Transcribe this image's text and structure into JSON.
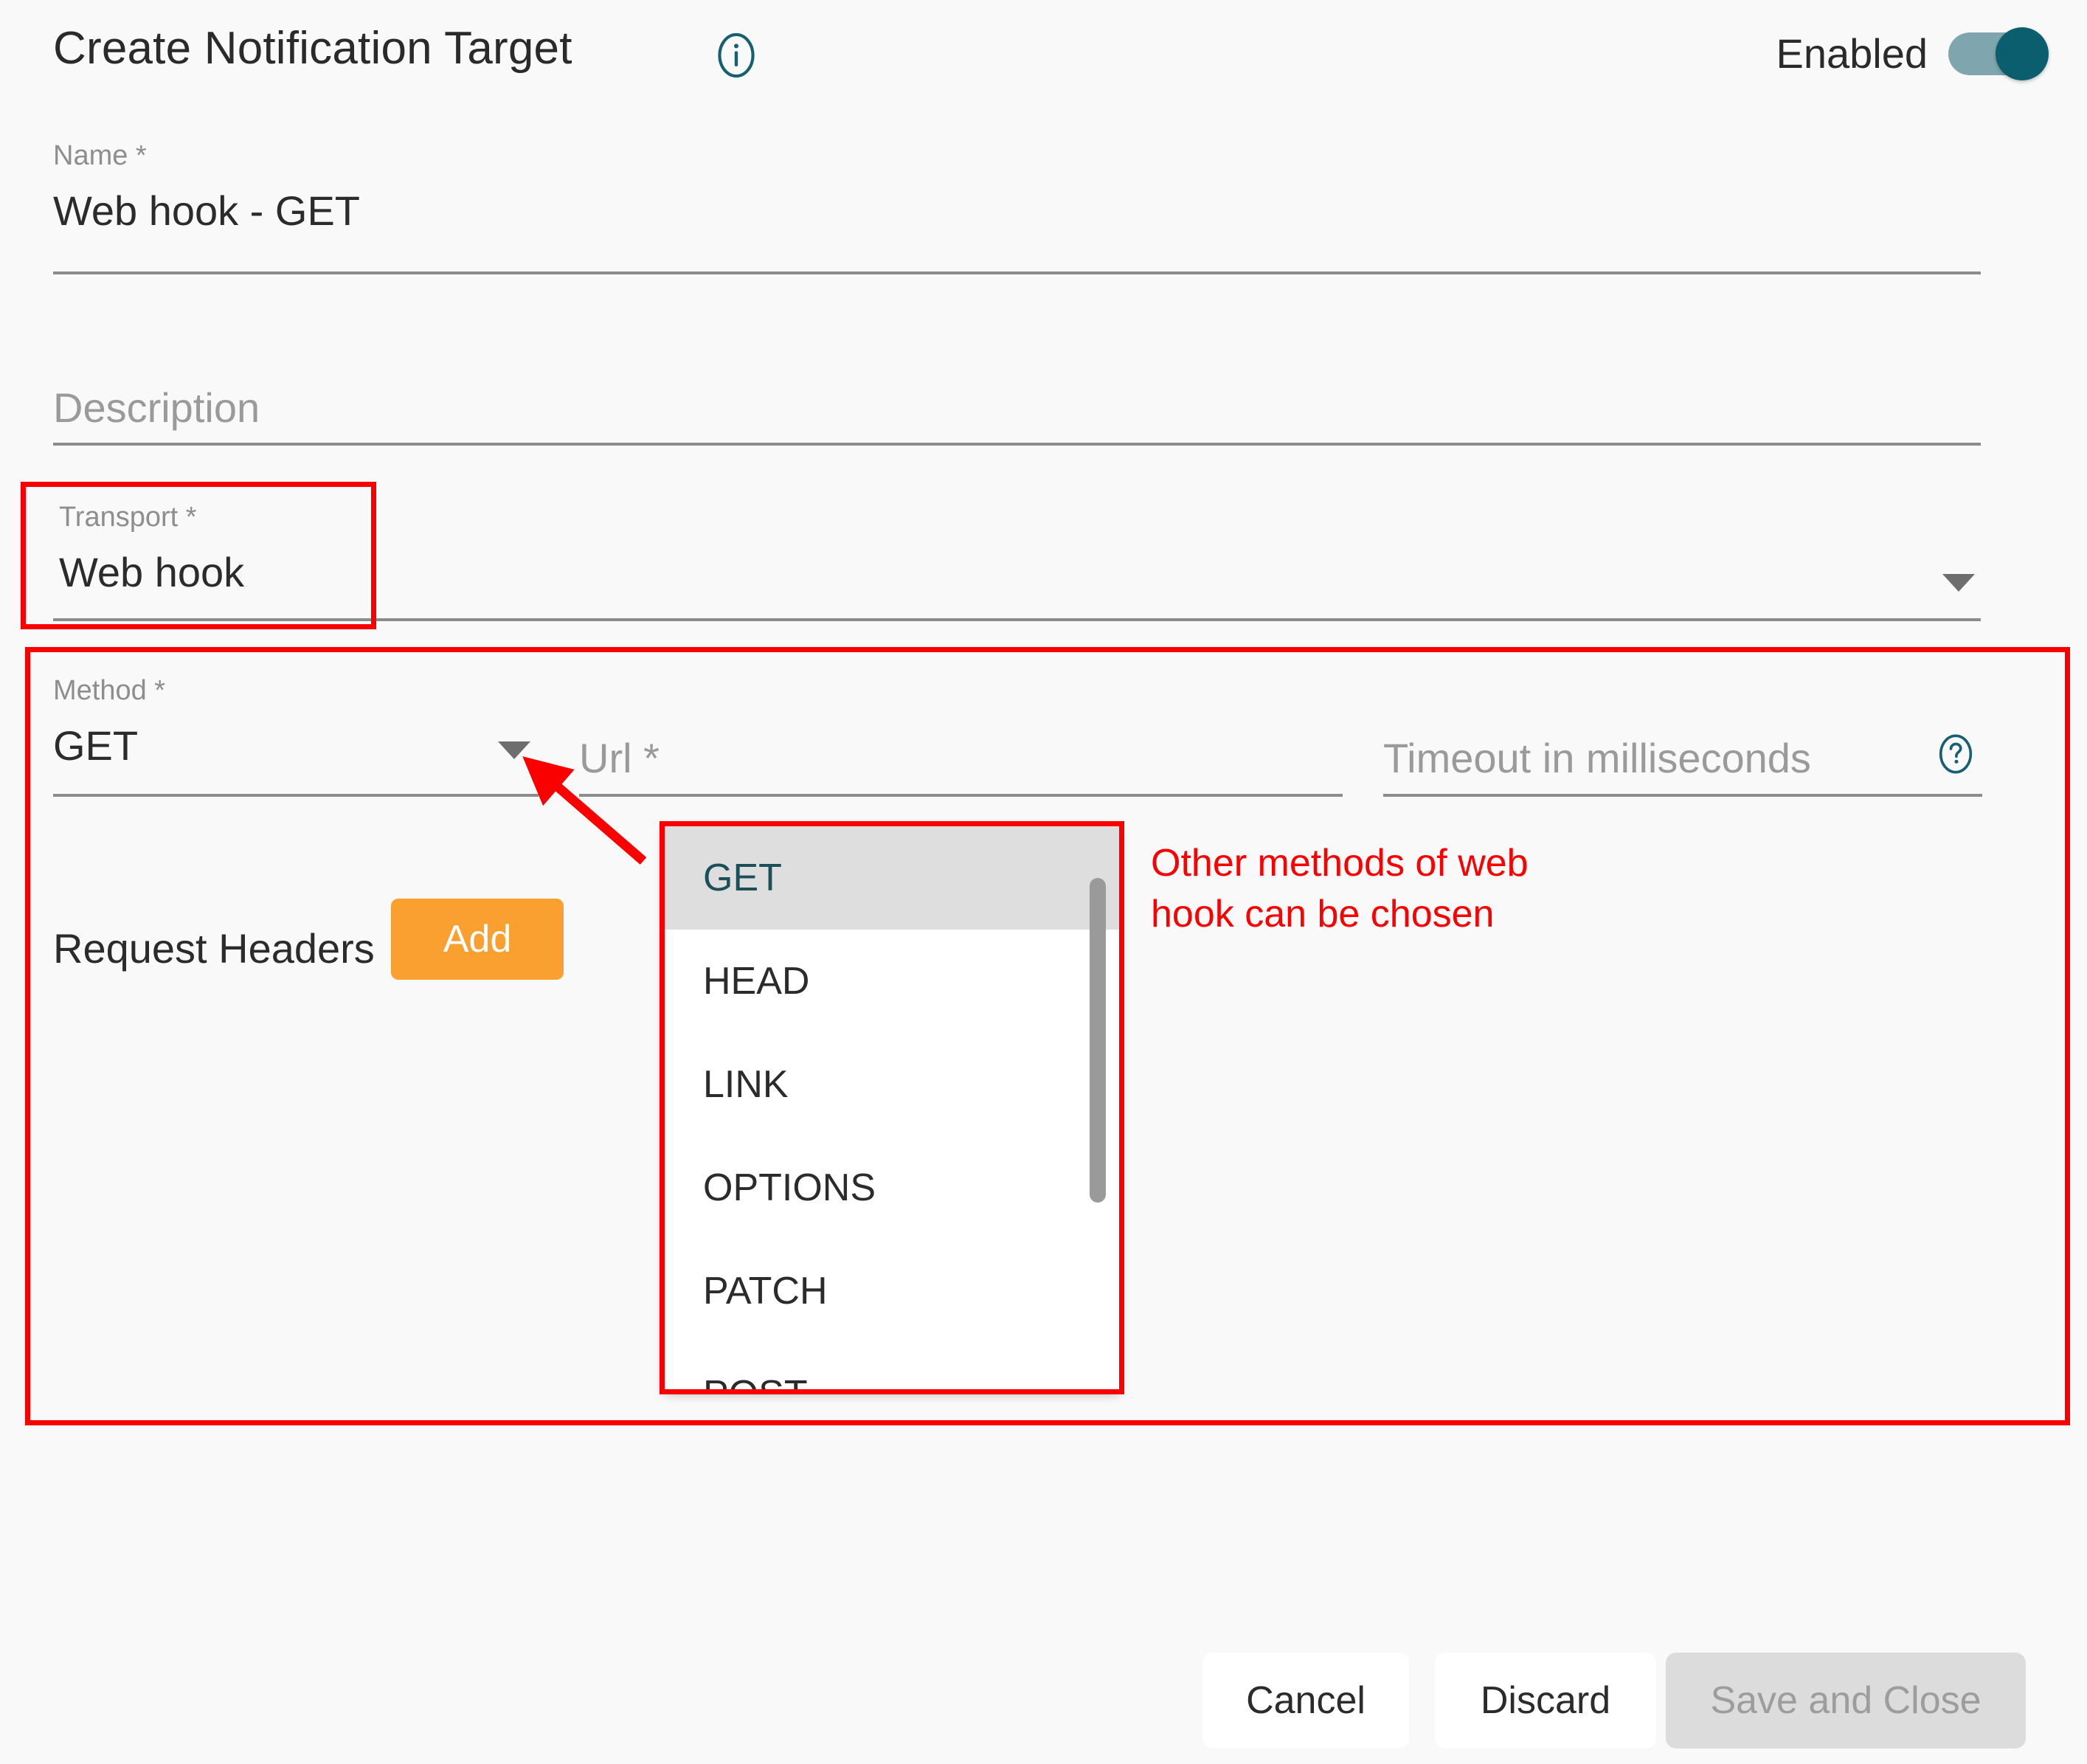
{
  "header": {
    "title": "Create Notification Target",
    "info_icon": "info-circle-icon",
    "toggle_label": "Enabled",
    "toggle_state": "on",
    "toggle_on_color": "#0b5e6e",
    "toggle_track_color": "#7fa6ae"
  },
  "fields": {
    "name": {
      "label": "Name *",
      "value": "Web hook - GET"
    },
    "description": {
      "label": "",
      "placeholder": "Description",
      "value": ""
    },
    "transport": {
      "label": "Transport *",
      "value": "Web hook",
      "caret_icon": "chevron-down-icon"
    },
    "method": {
      "label": "Method *",
      "value": "GET",
      "caret_icon": "chevron-down-icon"
    },
    "url": {
      "label": "",
      "placeholder": "Url *",
      "value": ""
    },
    "timeout": {
      "label": "",
      "placeholder": "Timeout in milliseconds",
      "value": "",
      "help_icon": "question-circle-icon"
    }
  },
  "method_dropdown": {
    "open": true,
    "selected": "GET",
    "options": [
      "GET",
      "HEAD",
      "LINK",
      "OPTIONS",
      "PATCH",
      "POST"
    ],
    "highlight_color": "#dedede"
  },
  "request_headers": {
    "label": "Request Headers",
    "add_label": "Add",
    "add_color": "#f9a031"
  },
  "footer": {
    "cancel_label": "Cancel",
    "discard_label": "Discard",
    "save_label": "Save and Close",
    "save_disabled": true
  },
  "annotations": {
    "callout_text": "Other methods of web\nhook can be chosen",
    "annotation_color": "#fb0000"
  }
}
